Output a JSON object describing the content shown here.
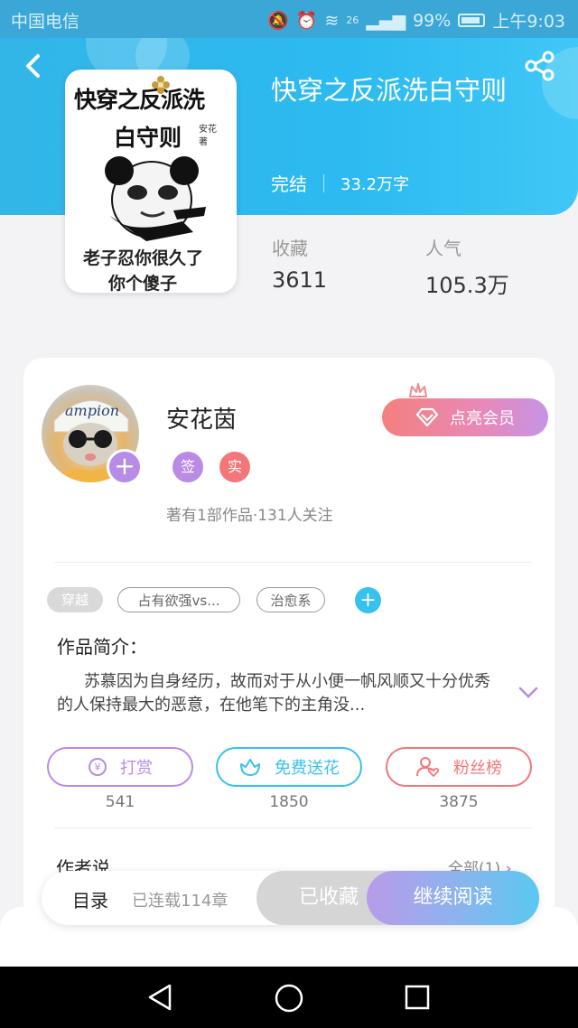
{
  "status_bar": {
    "carrier": "中国电信",
    "battery": "99%",
    "time": "上午9:03",
    "network": "26"
  },
  "book": {
    "title": "快穿之反派洗白守则",
    "status": "完结",
    "word_count": "33.2万字",
    "cover": {
      "title_line1": "快穿之反派洗",
      "title_line2": "白守则",
      "author_small": "安花 著",
      "caption1": "老子忍你很久了",
      "caption2": "你个傻子"
    },
    "stats": [
      {
        "label": "收藏",
        "value": "3611"
      },
      {
        "label": "人气",
        "value": "105.3万"
      }
    ]
  },
  "author": {
    "name": "安花茵",
    "badges": [
      {
        "text": "签",
        "color": "#b98ae6"
      },
      {
        "text": "实",
        "color": "#f2777a"
      }
    ],
    "meta": "著有1部作品·131人关注",
    "vip_button": "点亮会员",
    "avatar_plus": "+"
  },
  "tags": [
    {
      "text": "穿越",
      "style": "filled"
    },
    {
      "text": "占有欲强vs...",
      "style": "outline"
    },
    {
      "text": "治愈系",
      "style": "outline"
    }
  ],
  "intro": {
    "heading": "作品简介：",
    "text": "苏慕因为自身经历，故而对于从小便一帆风顺又十分优秀的人保持最大的恶意，在他笔下的主角没..."
  },
  "actions": [
    {
      "label": "打赏",
      "count": "541",
      "color": "#b98ae6",
      "icon": "coin-icon"
    },
    {
      "label": "免费送花",
      "count": "1850",
      "color": "#36c1ef",
      "icon": "flower-icon"
    },
    {
      "label": "粉丝榜",
      "count": "3875",
      "color": "#f2777a",
      "icon": "fan-ranking-icon"
    }
  ],
  "author_say": {
    "heading": "作者说",
    "all_link": "全部(1)"
  },
  "bottom_bar": {
    "toc": "目录",
    "serial": "已连载114章",
    "collected": "已收藏",
    "continue": "继续阅读"
  },
  "colors": {
    "header_blue": "#32b6e8",
    "purple": "#b98ae6",
    "pink": "#f2777a",
    "cyan": "#36c1ef"
  }
}
